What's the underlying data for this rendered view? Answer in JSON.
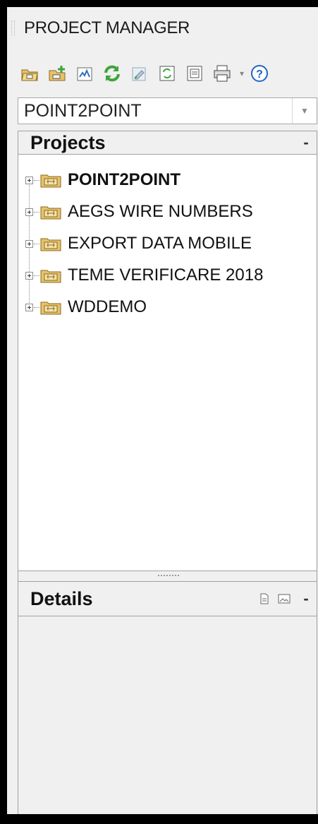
{
  "palette": {
    "frame_bg": "#f0f0f0",
    "tree_bg": "#ffffff",
    "border": "#a0a0a0",
    "folder_fill": "#e8c26a",
    "folder_stroke": "#8a6a1f",
    "green_accent": "#3fa53a",
    "help_blue": "#1e64c8"
  },
  "window": {
    "title": "PROJECT MANAGER"
  },
  "toolbar": {
    "buttons": [
      {
        "icon": "open-project-icon"
      },
      {
        "icon": "new-project-icon"
      },
      {
        "icon": "project-task-list-icon"
      },
      {
        "icon": "refresh-icon"
      },
      {
        "icon": "rebuild-icon"
      },
      {
        "icon": "update-retag-icon"
      },
      {
        "icon": "reports-icon"
      },
      {
        "icon": "publish-plot-icon"
      },
      {
        "icon": "help-icon"
      }
    ]
  },
  "project_selector": {
    "value": "POINT2POINT"
  },
  "projects_panel": {
    "title": "Projects",
    "collapse": "-",
    "items": [
      {
        "label": "POINT2POINT",
        "active": true
      },
      {
        "label": "AEGS WIRE NUMBERS",
        "active": false
      },
      {
        "label": "EXPORT DATA MOBILE",
        "active": false
      },
      {
        "label": "TEME VERIFICARE 2018",
        "active": false
      },
      {
        "label": "WDDEMO",
        "active": false
      }
    ]
  },
  "details_panel": {
    "title": "Details",
    "collapse": "-",
    "icons": [
      "details-view-icon",
      "thumbnail-view-icon"
    ]
  }
}
